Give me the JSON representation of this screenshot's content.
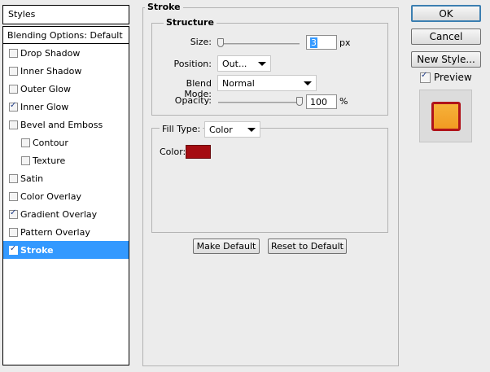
{
  "styles_panel": {
    "header": "Styles",
    "blending_options": "Blending Options: Default",
    "items": [
      {
        "label": "Drop Shadow",
        "checked": false
      },
      {
        "label": "Inner Shadow",
        "checked": false
      },
      {
        "label": "Outer Glow",
        "checked": false
      },
      {
        "label": "Inner Glow",
        "checked": true
      },
      {
        "label": "Bevel and Emboss",
        "checked": false
      },
      {
        "label": "Contour",
        "checked": false
      },
      {
        "label": "Texture",
        "checked": false
      },
      {
        "label": "Satin",
        "checked": false
      },
      {
        "label": "Color Overlay",
        "checked": false
      },
      {
        "label": "Gradient Overlay",
        "checked": true
      },
      {
        "label": "Pattern Overlay",
        "checked": false
      },
      {
        "label": "Stroke",
        "checked": true,
        "selected": true
      }
    ]
  },
  "stroke": {
    "title": "Stroke",
    "structure": {
      "title": "Structure",
      "size_label": "Size:",
      "size_value": "3",
      "size_unit": "px",
      "size_fraction": 0.03,
      "position_label": "Position:",
      "position_value": "Out...",
      "blend_mode_label": "Blend Mode:",
      "blend_mode_value": "Normal",
      "opacity_label": "Opacity:",
      "opacity_value": "100",
      "opacity_unit": "%",
      "opacity_fraction": 1.0
    },
    "fill": {
      "fill_type_label": "Fill Type:",
      "fill_type_value": "Color",
      "color_label": "Color:",
      "color_value": "#a50d12"
    },
    "make_default_label": "Make Default",
    "reset_default_label": "Reset to Default"
  },
  "actions": {
    "ok_label": "OK",
    "cancel_label": "Cancel",
    "new_style_label": "New Style...",
    "preview_label": "Preview",
    "preview_checked": true
  },
  "colors": {
    "selection": "#3399ff",
    "stroke_color": "#a50d12",
    "preview_fill": "#f4a82f"
  }
}
